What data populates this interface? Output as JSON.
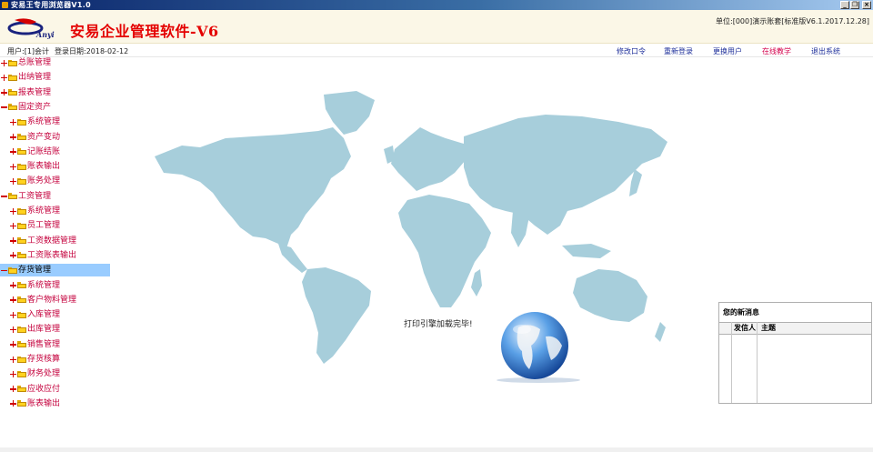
{
  "window": {
    "title": "安易王专用浏览器V1.0"
  },
  "header": {
    "app_title": "安易企业管理软件-V6",
    "logo_text": "Anyi",
    "unit_info": "单位:[000]演示账套[标准版V6.1.2017.12.28]"
  },
  "info": {
    "user": "用户:[1]会计",
    "login_date": "登录日期:2018-02-12",
    "links": [
      "修改口令",
      "重新登录",
      "更换用户",
      "在线教学",
      "退出系统"
    ]
  },
  "tree": [
    {
      "label": "总账管理",
      "toggle": "plus",
      "level": 0
    },
    {
      "label": "出纳管理",
      "toggle": "plus",
      "level": 0
    },
    {
      "label": "报表管理",
      "toggle": "plus",
      "level": 0
    },
    {
      "label": "固定资产",
      "toggle": "minus",
      "level": 0
    },
    {
      "label": "系统管理",
      "toggle": "plus",
      "level": 1
    },
    {
      "label": "资产变动",
      "toggle": "plus",
      "level": 1
    },
    {
      "label": "记账结账",
      "toggle": "plus",
      "level": 1
    },
    {
      "label": "账表输出",
      "toggle": "plus",
      "level": 1
    },
    {
      "label": "账务处理",
      "toggle": "plus",
      "level": 1
    },
    {
      "label": "工资管理",
      "toggle": "minus",
      "level": 0
    },
    {
      "label": "系统管理",
      "toggle": "plus",
      "level": 1
    },
    {
      "label": "员工管理",
      "toggle": "plus",
      "level": 1
    },
    {
      "label": "工资数据管理",
      "toggle": "plus",
      "level": 1
    },
    {
      "label": "工资账表输出",
      "toggle": "plus",
      "level": 1
    },
    {
      "label": "存货管理",
      "toggle": "minus",
      "level": 0,
      "selected": true
    },
    {
      "label": "系统管理",
      "toggle": "plus",
      "level": 1
    },
    {
      "label": "客户物料管理",
      "toggle": "plus",
      "level": 1
    },
    {
      "label": "入库管理",
      "toggle": "plus",
      "level": 1
    },
    {
      "label": "出库管理",
      "toggle": "plus",
      "level": 1
    },
    {
      "label": "销售管理",
      "toggle": "plus",
      "level": 1
    },
    {
      "label": "存货核算",
      "toggle": "plus",
      "level": 1
    },
    {
      "label": "财务处理",
      "toggle": "plus",
      "level": 1
    },
    {
      "label": "应收应付",
      "toggle": "plus",
      "level": 1
    },
    {
      "label": "账表输出",
      "toggle": "plus",
      "level": 1
    }
  ],
  "main": {
    "status": "打印引擎加载完毕!"
  },
  "messages": {
    "title": "您的新消息",
    "col_sender": "发信人",
    "col_subject": "主题"
  },
  "icons": {
    "folder": "folder-icon",
    "expand": "plus-icon",
    "collapse": "minus-icon"
  },
  "colors": {
    "tree_text": "#c4003c",
    "selected_bg": "#99ccff",
    "app_title": "#e40000",
    "link": "#1e2f9a",
    "map": "#a7cedb",
    "header_bg": "#fbf7e7"
  }
}
